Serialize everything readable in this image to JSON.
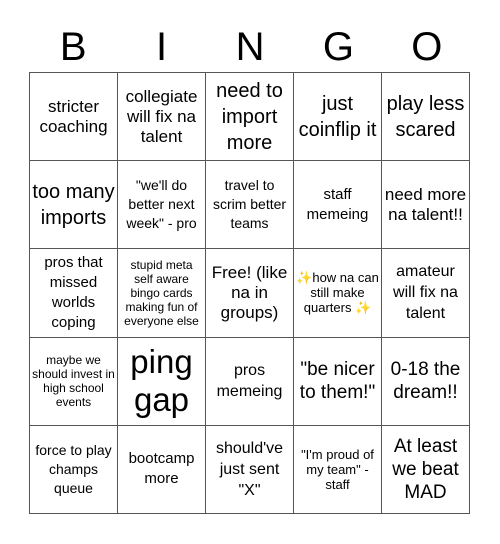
{
  "header": [
    "B",
    "I",
    "N",
    "G",
    "O"
  ],
  "cells": [
    "stricter coaching",
    "collegiate will fix na talent",
    "need to import more",
    "just coinflip it",
    "play less scared",
    "too many imports",
    "\"we'll do better next week\" - pro",
    "travel to scrim better teams",
    "staff memeing",
    "need more na talent!!",
    "pros that missed worlds coping",
    "stupid meta self aware bingo cards making fun of everyone else",
    "Free! (like na in groups)",
    "✨how na can still make quarters ✨",
    "amateur will fix na talent",
    "maybe we should invest in high school events",
    "ping gap",
    "pros memeing",
    "\"be nicer to them!\"",
    "0-18 the dream!!",
    "force to play champs queue",
    "bootcamp more",
    "should've just sent \"X\"",
    "\"I'm proud of my team\" - staff",
    "At least we beat MAD"
  ]
}
